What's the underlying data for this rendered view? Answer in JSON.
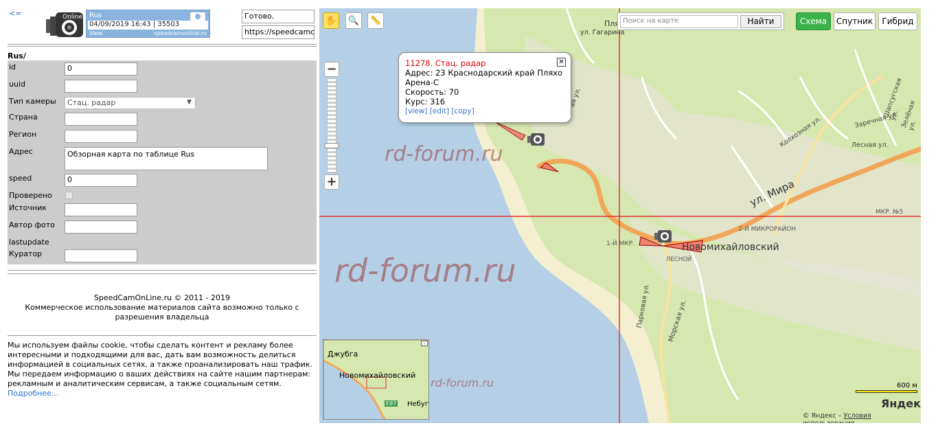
{
  "header": {
    "back_label": "<=",
    "badge_title": "Rus",
    "badge_info": "04/09/2019 16:43 | 35503",
    "badge_view": "View",
    "badge_site": "speedcamonline.ru",
    "status_value": "Готово.",
    "url_value": "https://speedcamon"
  },
  "form": {
    "section_title": "Rus/",
    "fields": {
      "id_label": "id",
      "id_value": "0",
      "uuid_label": "uuid",
      "uuid_value": "",
      "type_label": "Тип камеры",
      "type_value": "Стац. радар",
      "country_label": "Страна",
      "country_value": "",
      "region_label": "Регион",
      "region_value": "",
      "address_label": "Адрес",
      "address_value": "Обзорная карта по таблице Rus",
      "speed_label": "speed",
      "speed_value": "0",
      "checked_label": "Проверено",
      "source_label": "Источник",
      "source_value": "",
      "photo_author_label": "Автор фото",
      "photo_author_value": "",
      "lastupdate_label": "lastupdate",
      "curator_label": "Куратор",
      "curator_value": ""
    }
  },
  "footer": {
    "copyright": "SpeedCamOnLine.ru © 2011 - 2019",
    "notice": "Коммерческое использование материалов сайта возможно только с разрешения владельца"
  },
  "cookie": {
    "text": "Мы используем файлы cookie, чтобы сделать контент и рекламу более интересными и подходящими для вас, дать вам возможность делиться информацией в социальных сетях, а также проанализировать наш трафик. Мы передаем информацию о ваших действиях на сайте нашим партнерам: рекламным и аналитическим сервисам, а также социальным сетям. ",
    "more_link": "Подробнее..."
  },
  "map": {
    "search_placeholder": "Поиск на карте",
    "search_button": "Найти",
    "modes": [
      "Схема",
      "Спутник",
      "Гибрид"
    ],
    "active_mode": "Схема",
    "balloon": {
      "title": "11278. Стац. радар",
      "address": "Адрес: 23 Краснодарский край Пляхо",
      "address2": "Арена-С",
      "speed": "Скорость: 70",
      "course": "Курс: 316",
      "link_view": "[view]",
      "link_edit": "[edit]",
      "link_copy": "[copy]"
    },
    "labels": {
      "gagarina": "ул. Гагарина",
      "plya": "Пля",
      "mira": "ул. Мира",
      "town": "Новомихайловский",
      "mkr1": "1-Й МКР.",
      "mkr2": "2-Й МИКРОРАЙОН",
      "mkr5": "МКР. №5",
      "lesnoy": "ЛЕСНОЙ",
      "kolkhoznaya": "Колхозная ул.",
      "zarechnaya": "Заречная ул.",
      "lesnaya": "Лесная ул.",
      "shapsugskaya": "Шапсугская ул.",
      "zelenaya": "Зелёная ул.",
      "morskaya": "Морская ул.",
      "parkovaya": "Парковая ул.",
      "ya": "ая ул."
    },
    "watermark": "rd-forum.ru",
    "minimap": {
      "dzhubga": "Джубга",
      "town": "Новомихайловский",
      "nebug": "Небуг",
      "road": "E97"
    },
    "scale": "600 м",
    "brand": "Яндекс",
    "copyright": "© Яндекс – ",
    "terms": "Условия использования"
  },
  "colors": {
    "active_mode": "#3bb34a",
    "road": "#f2a65a",
    "land": "#d6e8b0",
    "water": "#b5d0e6",
    "crosshair": "#e03030"
  }
}
